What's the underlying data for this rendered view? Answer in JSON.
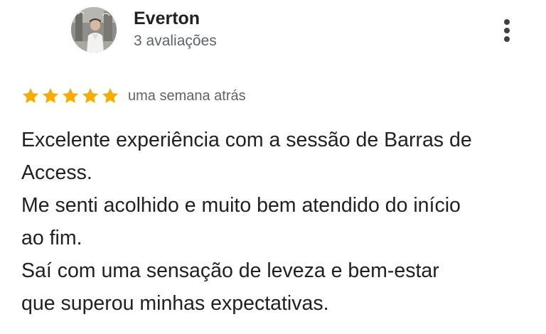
{
  "reviewer": {
    "name": "Everton",
    "meta": "3 avaliações",
    "avatar": "profile-photo"
  },
  "menu": {
    "icon": "more-vert-icon"
  },
  "rating": {
    "stars": 5,
    "max_stars": 5,
    "star_color": "#f9ab00",
    "date": "uma semana atrás"
  },
  "review": {
    "lines": [
      "Excelente experiência com a sessão de Barras de",
      "Access.",
      "Me senti acolhido e muito bem atendido do início",
      "ao fim.",
      "Saí com uma sensação de leveza e bem-estar",
      "que superou minhas expectativas."
    ]
  },
  "colors": {
    "primary_text": "#202124",
    "secondary_text": "#5f6368",
    "background": "#ffffff"
  }
}
